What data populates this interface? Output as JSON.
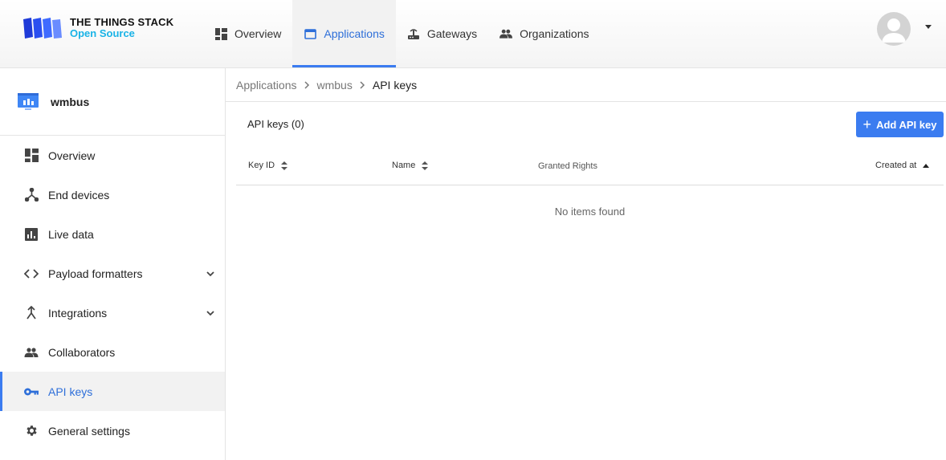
{
  "logo": {
    "title": "THE THINGS STACK",
    "subtitle": "Open Source"
  },
  "topnav": {
    "items": [
      {
        "label": "Overview",
        "icon": "dashboard-icon"
      },
      {
        "label": "Applications",
        "icon": "application-icon",
        "active": true
      },
      {
        "label": "Gateways",
        "icon": "gateway-icon"
      },
      {
        "label": "Organizations",
        "icon": "organization-icon"
      }
    ]
  },
  "sidebar": {
    "app_name": "wmbus",
    "items": [
      {
        "label": "Overview",
        "icon": "dashboard-icon"
      },
      {
        "label": "End devices",
        "icon": "devices-icon"
      },
      {
        "label": "Live data",
        "icon": "chart-icon"
      },
      {
        "label": "Payload formatters",
        "icon": "code-icon",
        "expandable": true
      },
      {
        "label": "Integrations",
        "icon": "merge-icon",
        "expandable": true
      },
      {
        "label": "Collaborators",
        "icon": "people-icon"
      },
      {
        "label": "API keys",
        "icon": "key-icon",
        "active": true
      },
      {
        "label": "General settings",
        "icon": "gear-icon"
      }
    ]
  },
  "breadcrumb": [
    "Applications",
    "wmbus",
    "API keys"
  ],
  "table": {
    "title": "API keys (0)",
    "add_button": "Add API key",
    "columns": [
      "Key ID",
      "Name",
      "Granted Rights",
      "Created at"
    ],
    "empty_text": "No items found"
  },
  "colors": {
    "accent": "#3b7cf0",
    "logo_sub": "#19b3e6"
  }
}
